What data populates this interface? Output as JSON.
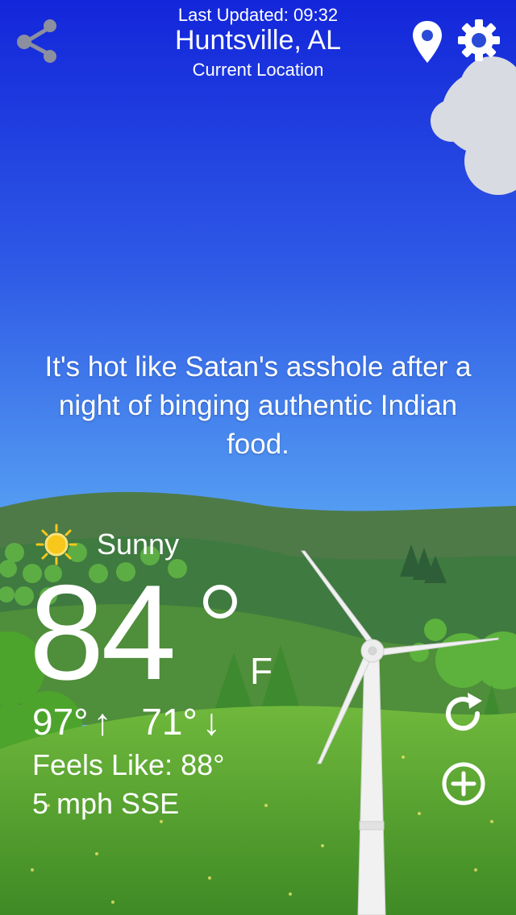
{
  "header": {
    "last_updated": "Last Updated: 09:32",
    "city": "Huntsville, AL",
    "location_label": "Current Location"
  },
  "message": "It's hot like Satan's asshole after a night of binging authentic Indian food.",
  "weather": {
    "condition": "Sunny",
    "temperature": "84",
    "unit": "F",
    "high": "97°",
    "low": "71°",
    "feels_like": "Feels Like: 88°",
    "wind": "5 mph SSE"
  },
  "icons": {
    "share": "share-icon",
    "location": "location-pin-icon",
    "settings": "gear-icon",
    "condition": "sun-icon",
    "refresh": "refresh-icon",
    "add": "plus-circle-icon",
    "up": "↑",
    "down": "↓"
  },
  "colors": {
    "sky_top": "#1428d8",
    "sky_bottom": "#5fb0f6",
    "grass": "#4f9a2a",
    "sun": "#f7c81b"
  }
}
